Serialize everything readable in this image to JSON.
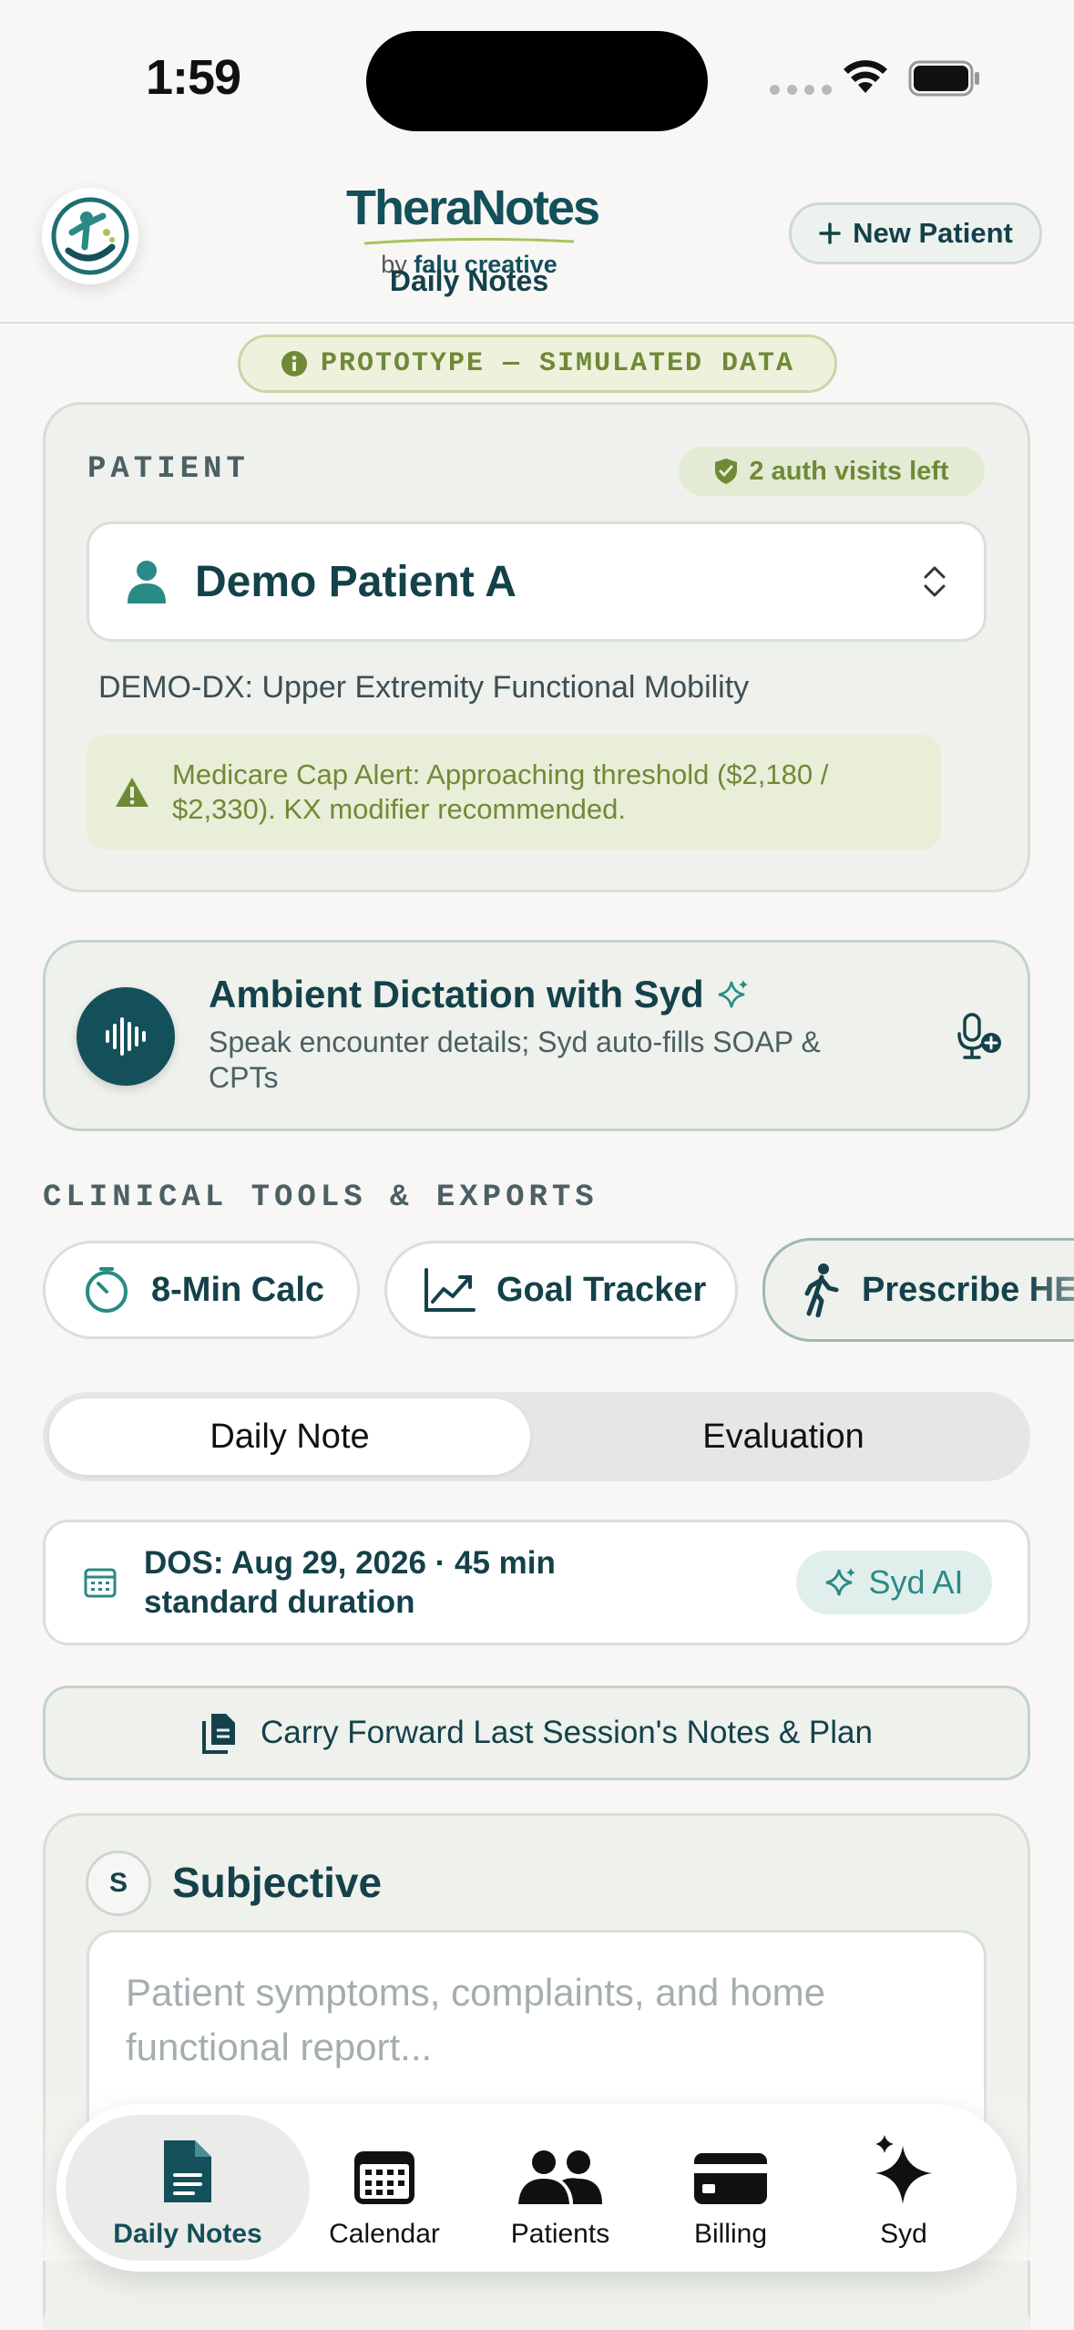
{
  "status_bar": {
    "time": "1:59"
  },
  "header": {
    "brand_name": "TheraNotes",
    "brand_by_prefix": "by ",
    "brand_by_company": "falu creative",
    "subtitle": "Daily Notes",
    "new_patient_label": "New Patient"
  },
  "prototype_banner": "PROTOTYPE — SIMULATED DATA",
  "patient": {
    "section_label": "PATIENT",
    "auth_badge": "2 auth visits left",
    "name": "Demo Patient A",
    "diagnosis": "DEMO-DX: Upper Extremity Functional Mobility",
    "alert": "Medicare Cap Alert: Approaching threshold ($2,180 / $2,330). KX modifier recommended."
  },
  "dictation": {
    "title": "Ambient Dictation with Syd",
    "subtitle": "Speak encounter details; Syd auto-fills SOAP & CPTs"
  },
  "tools": {
    "section_label": "CLINICAL TOOLS & EXPORTS",
    "items": [
      {
        "label": "8-Min Calc",
        "icon": "timer-icon"
      },
      {
        "label": "Goal Tracker",
        "icon": "trend-chart-icon"
      },
      {
        "label": "Prescribe HEP",
        "icon": "walking-person-icon"
      }
    ]
  },
  "note_tabs": {
    "active": "Daily Note",
    "inactive": "Evaluation"
  },
  "dos": {
    "text": "DOS: Aug 29, 2026 · 45 min standard duration",
    "syd_ai_label": "Syd AI"
  },
  "carry_forward_label": "Carry Forward Last Session's Notes & Plan",
  "subjective": {
    "badge": "S",
    "title": "Subjective",
    "placeholder": "Patient symptoms, complaints, and home functional report..."
  },
  "tab_bar": {
    "items": [
      {
        "label": "Daily Notes",
        "icon": "document-icon",
        "active": true
      },
      {
        "label": "Calendar",
        "icon": "calendar-icon",
        "active": false
      },
      {
        "label": "Patients",
        "icon": "people-icon",
        "active": false
      },
      {
        "label": "Billing",
        "icon": "credit-card-icon",
        "active": false
      },
      {
        "label": "Syd",
        "icon": "sparkles-icon",
        "active": false
      }
    ]
  },
  "colors": {
    "primary": "#14505a",
    "accent_teal": "#2a8a85",
    "olive": "#6f8a37",
    "background": "#f8f7f5",
    "card": "#eef1ec"
  }
}
